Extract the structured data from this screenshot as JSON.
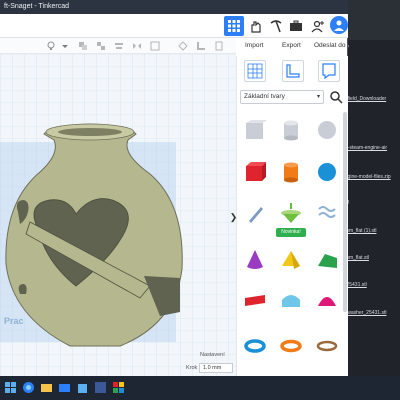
{
  "window": {
    "title": "ft-Snaget - Tinkercad"
  },
  "topnav": {
    "avatar_initial": "O"
  },
  "actions": {
    "import": "Import",
    "export": "Export",
    "send": "Odeslat do"
  },
  "panel": {
    "category": "Základní tvary",
    "new_badge": "Novinka!"
  },
  "workplane": {
    "watermark": "Prac",
    "edit_grid": "Nastavení",
    "snap_label": "Krok",
    "snap_value": "1.0 mm"
  },
  "background_window": {
    "items": [
      "ory",
      "ndfield_Downloader",
      "ort-steam-engine-air",
      "engine-model-files.zip",
      "ndf",
      "5mm_flat (1).stl",
      "5mm_flat.stl",
      "e-25431.stl",
      "s_washer_25431.stl"
    ]
  }
}
